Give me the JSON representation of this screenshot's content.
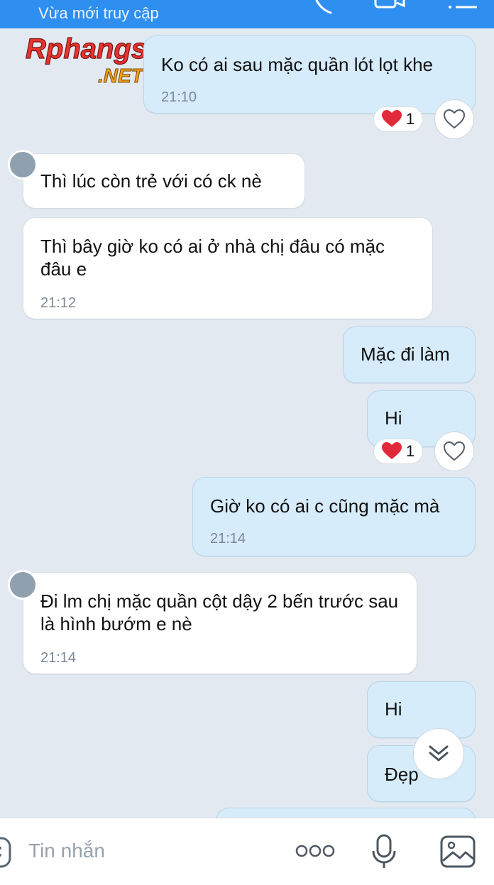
{
  "header": {
    "status_text": "Vừa mới truy cập"
  },
  "watermark": {
    "line1": "Rphangs",
    "line2": ".NET"
  },
  "messages": [
    {
      "direction": "out",
      "text": "Ko có ai sau mặc quần lót lọt khe",
      "time": "21:10",
      "reaction": {
        "emoji": "heart",
        "count": "1"
      }
    },
    {
      "direction": "in",
      "text": "Thì lúc còn trẻ với có ck nè"
    },
    {
      "direction": "in",
      "text": "Thì bây giờ ko có ai ở nhà chị đâu có mặc đâu e",
      "time": "21:12"
    },
    {
      "direction": "out",
      "text": "Mặc đi làm"
    },
    {
      "direction": "out",
      "text": "Hi",
      "reaction": {
        "emoji": "heart",
        "count": "1"
      }
    },
    {
      "direction": "out",
      "text": "Giờ ko có ai c cũng mặc mà",
      "time": "21:14"
    },
    {
      "direction": "in",
      "text": "Đi lm chị mặc quần cột dậy 2 bến trước sau là hình bướm e nè",
      "time": "21:14"
    },
    {
      "direction": "out",
      "text": "Hi"
    },
    {
      "direction": "out",
      "text": "Đẹp"
    }
  ],
  "composer": {
    "placeholder": "Tin nhắn"
  },
  "colors": {
    "header": "#2f8ff0",
    "background": "#e2e9f1",
    "outgoing_bubble": "#d6ecfb",
    "incoming_bubble": "#ffffff",
    "heart": "#e02a3a"
  },
  "icons": [
    "call-icon",
    "video-call-icon",
    "menu-icon",
    "heart-reaction-icon",
    "like-heart-icon",
    "scroll-down-icon",
    "sticker-icon",
    "more-options-icon",
    "microphone-icon",
    "image-icon"
  ]
}
